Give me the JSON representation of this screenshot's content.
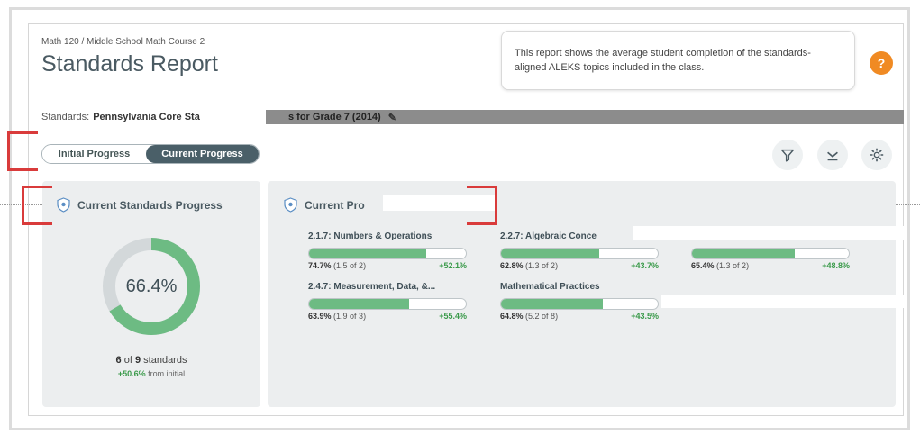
{
  "header": {
    "breadcrumb": "Math 120 / Middle School Math Course 2",
    "title": "Standards Report"
  },
  "info_popover": {
    "text": "This report shows the average student completion of the standards-aligned ALEKS topics included in the class.",
    "help_icon": "?"
  },
  "standards": {
    "label": "Standards:",
    "name_start": "Pennsylvania Core Sta",
    "name_end": "s for Grade 7 (2014)"
  },
  "toggle": {
    "initial_label": "Initial Progress",
    "current_label": "Current Progress",
    "selected": "current"
  },
  "toolbar": {
    "filter_icon": "filter-icon",
    "download_icon": "download-icon",
    "settings_icon": "gear-icon"
  },
  "left_panel": {
    "title": "Current Standards Progress",
    "percent_value": 66.4,
    "percent_label": "66.4%",
    "count_mastered": "6",
    "count_total": "9",
    "count_of": "of",
    "count_unit": "standards",
    "gain": "+50.6%",
    "gain_suffix": "from initial"
  },
  "right_panel": {
    "title": "Current Pro",
    "items": [
      {
        "title": "2.1.7: Numbers & Operations",
        "pct": "74.7%",
        "detail": "(1.5 of 2)",
        "gain": "+52.1%",
        "fill": 0.747
      },
      {
        "title": "2.2.7: Algebraic Conce",
        "pct": "62.8%",
        "detail": "(1.3 of 2)",
        "gain": "+43.7%",
        "fill": 0.628
      },
      {
        "title": "",
        "pct": "65.4%",
        "detail": "(1.3 of 2)",
        "gain": "+48.8%",
        "fill": 0.654
      },
      {
        "title": "2.4.7: Measurement, Data, &...",
        "pct": "63.9%",
        "detail": "(1.9 of 3)",
        "gain": "+55.4%",
        "fill": 0.639
      },
      {
        "title": "Mathematical Practices",
        "pct": "64.8%",
        "detail": "(5.2 of 8)",
        "gain": "+43.5%",
        "fill": 0.648
      }
    ]
  },
  "colors": {
    "accent": "#6dbb83",
    "toggle_active": "#4a5f68",
    "help": "#f08a23",
    "highlight": "#d93b3b",
    "donut_track": "#d3d8da"
  }
}
